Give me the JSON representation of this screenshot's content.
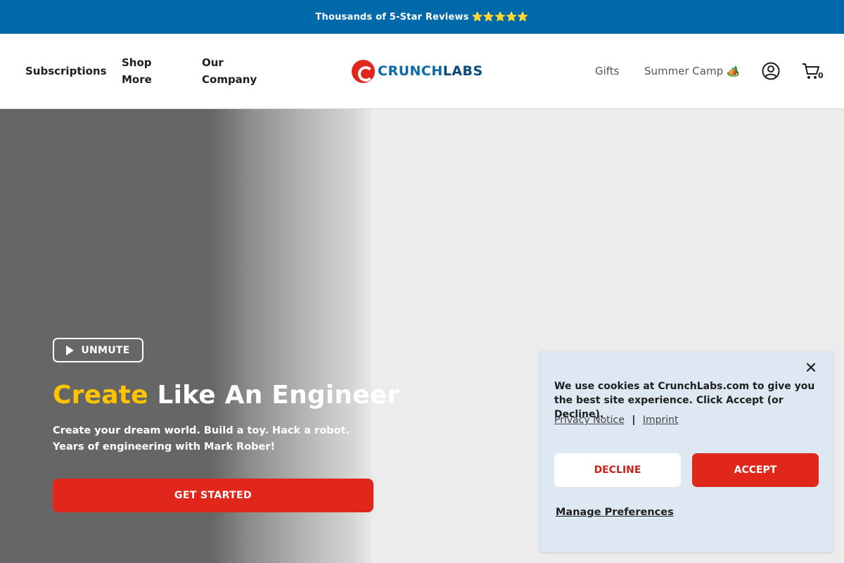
{
  "announcement": {
    "text": "Thousands of 5-Star Reviews",
    "stars": "⭐⭐⭐⭐⭐"
  },
  "nav": {
    "subscriptions": "Subscriptions",
    "shop_more": "Shop More",
    "our_company": "Our Company",
    "gifts": "Gifts",
    "summer_camp": "Summer Camp 🏕️",
    "cart_count": "0"
  },
  "logo": {
    "part1": "CRUNCH",
    "part2": "LABS"
  },
  "hero": {
    "unmute_label": "UNMUTE",
    "title_accent": "Create",
    "title_rest": " Like An Engineer",
    "subtitle": "Create your dream world. Build a toy. Hack a robot. Years of engineering with Mark Rober!",
    "cta_label": "GET STARTED"
  },
  "cookie": {
    "message": "We use cookies at CrunchLabs.com to give you the best site experience. Click Accept (or Decline).",
    "privacy_link": "Privacy Notice",
    "imprint_link": "Imprint",
    "decline_label": "DECLINE",
    "accept_label": "ACCEPT",
    "manage_label": "Manage Preferences"
  },
  "colors": {
    "announce_bg": "#0069aa",
    "brand_red": "#e1261c",
    "accent_yellow": "#ffc400",
    "cookie_bg": "#dde8f2"
  },
  "icons": [
    "user-icon",
    "cart-icon",
    "play-icon",
    "close-icon",
    "logo-icon"
  ]
}
